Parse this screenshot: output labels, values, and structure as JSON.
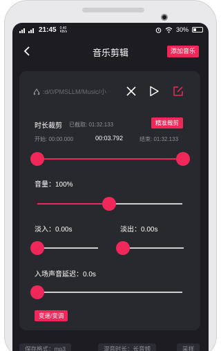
{
  "status_bar": {
    "signal": "4G",
    "time": "21:45",
    "speed_value": "0.40",
    "speed_unit": "KB/s",
    "battery": "30%"
  },
  "nav": {
    "title": "音乐剪辑",
    "add_music_label": "添加音乐"
  },
  "file": {
    "path": ":d/0/PMSLLM/Music/小"
  },
  "trim": {
    "title": "时长裁剪",
    "trimmed_label": "已截取: 01:32.133",
    "precise_button": "精准裁剪",
    "start_label": "开始: 00:00.000",
    "current": "00:03.792",
    "end_label": "结束: 01:32.133",
    "range": [
      0.0,
      1.0
    ]
  },
  "volume": {
    "label": "音量：100%",
    "level": 0.5
  },
  "fade_in": {
    "label": "淡入：0.00s",
    "level": 0.0
  },
  "fade_out": {
    "label": "淡出：0.00s",
    "level": 0.0
  },
  "delay": {
    "label": "入场声音延迟：0.0s",
    "level": 0.0
  },
  "speed_button": "变速/变调",
  "bottom": {
    "format_label": "保存格式：mp3",
    "mix_label": "混音时长：长音频",
    "sample_label": "采样"
  },
  "colors": {
    "accent": "#f0285a",
    "background": "#1c1c22",
    "card": "#28282f",
    "track": "#cfcfd4"
  }
}
